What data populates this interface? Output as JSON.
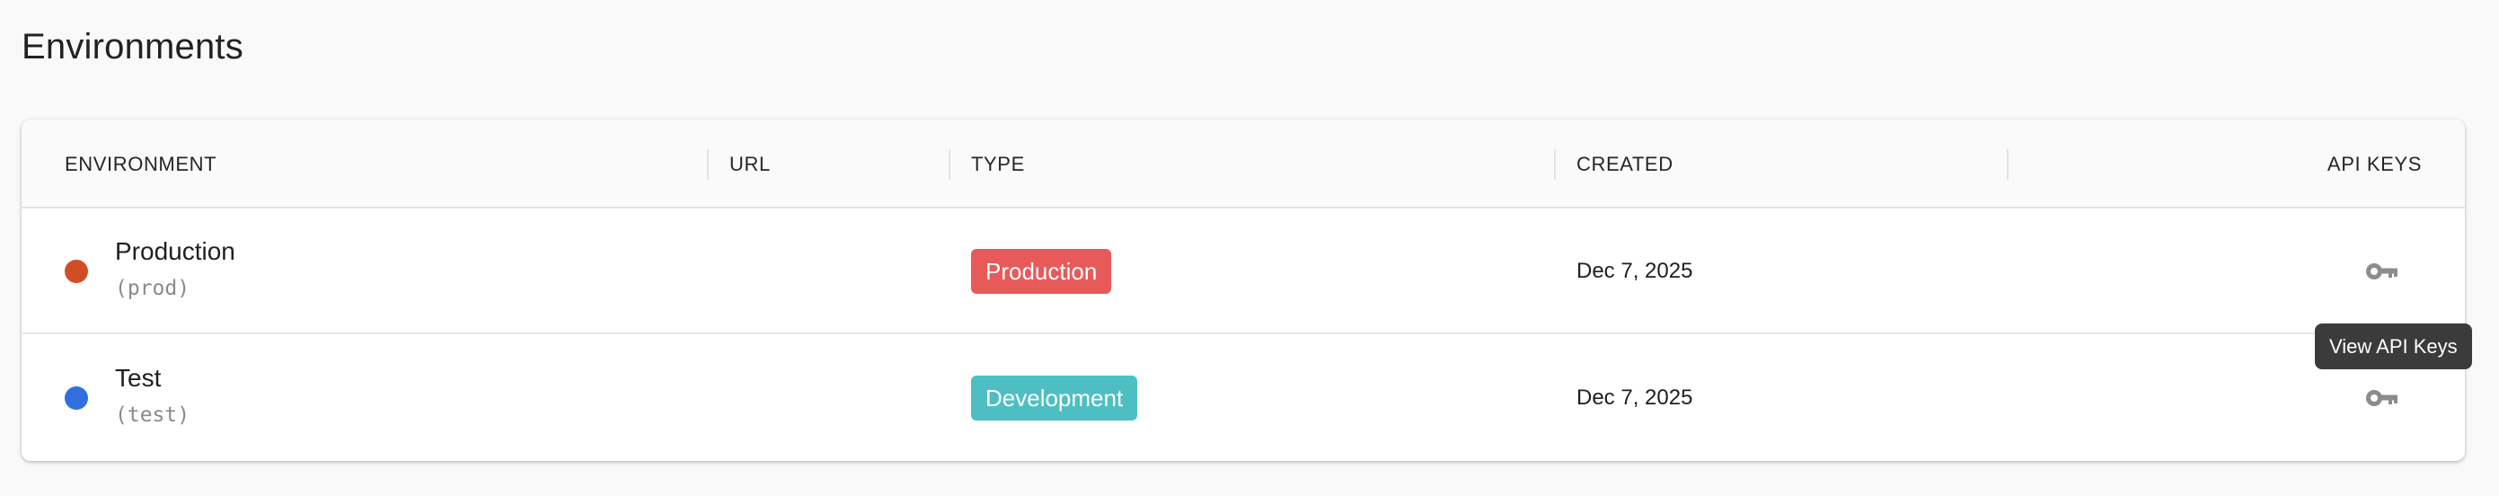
{
  "page": {
    "title": "Environments"
  },
  "table": {
    "columns": {
      "environment": "ENVIRONMENT",
      "url": "URL",
      "type": "TYPE",
      "created": "CREATED",
      "api_keys": "API KEYS"
    },
    "rows": [
      {
        "name": "Production",
        "key": "(prod)",
        "dot_color": "#d04e22",
        "url": "",
        "type": "Production",
        "type_color": "#e85a5a",
        "created": "Dec 7, 2025",
        "api_keys_icon": "key-icon"
      },
      {
        "name": "Test",
        "key": "(test)",
        "dot_color": "#2f6fde",
        "url": "",
        "type": "Development",
        "type_color": "#4dbfc3",
        "created": "Dec 7, 2025",
        "api_keys_icon": "key-icon"
      }
    ]
  },
  "tooltip": {
    "text": "View API Keys"
  }
}
